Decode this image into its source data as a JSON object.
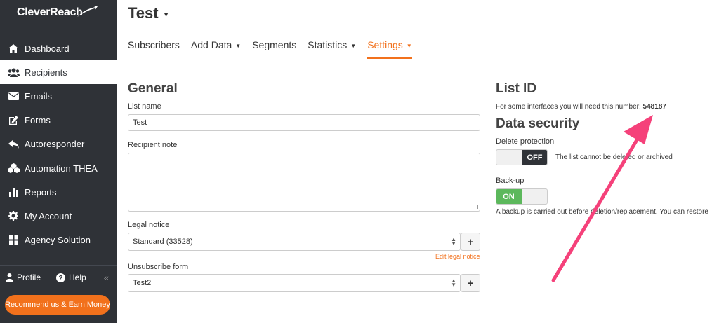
{
  "app": {
    "logo_text": "CleverReach"
  },
  "sidebar": {
    "items": [
      {
        "label": "Dashboard",
        "icon": "home-icon"
      },
      {
        "label": "Recipients",
        "icon": "users-icon"
      },
      {
        "label": "Emails",
        "icon": "envelope-icon"
      },
      {
        "label": "Forms",
        "icon": "edit-icon"
      },
      {
        "label": "Autoresponder",
        "icon": "reply-icon"
      },
      {
        "label": "Automation THEA",
        "icon": "cubes-icon"
      },
      {
        "label": "Reports",
        "icon": "bar-chart-icon"
      },
      {
        "label": "My Account",
        "icon": "gear-icon"
      },
      {
        "label": "Agency Solution",
        "icon": "grid-icon"
      }
    ],
    "active_index": 1,
    "profile_label": "Profile",
    "help_label": "Help",
    "collapse_label": "«",
    "recommend_label": "Recommend us & Earn Money"
  },
  "header": {
    "title": "Test"
  },
  "tabs": [
    {
      "label": "Subscribers",
      "dropdown": false
    },
    {
      "label": "Add Data",
      "dropdown": true
    },
    {
      "label": "Segments",
      "dropdown": false
    },
    {
      "label": "Statistics",
      "dropdown": true
    },
    {
      "label": "Settings",
      "dropdown": true,
      "active": true
    }
  ],
  "general": {
    "heading": "General",
    "list_name_label": "List name",
    "list_name_value": "Test",
    "recipient_note_label": "Recipient note",
    "legal_notice_label": "Legal notice",
    "legal_notice_value": "Standard (33528)",
    "edit_legal_notice": "Edit legal notice",
    "unsubscribe_label": "Unsubscribe form",
    "unsubscribe_value": "Test2",
    "plus": "+"
  },
  "list_id": {
    "heading": "List ID",
    "text": "For some interfaces you will need this number:",
    "value": "548187"
  },
  "data_security": {
    "heading": "Data security",
    "delete_protection_label": "Delete protection",
    "delete_protection_state": "OFF",
    "delete_protection_note": "The list cannot be deleted or archived",
    "backup_label": "Back-up",
    "backup_state": "ON",
    "backup_note": "A backup is carried out before deletion/replacement. You can restore"
  },
  "colors": {
    "accent": "#f2711c",
    "sidebar_bg": "#2f3237",
    "on_green": "#5cb85c",
    "annotation_arrow": "#f5417a"
  }
}
